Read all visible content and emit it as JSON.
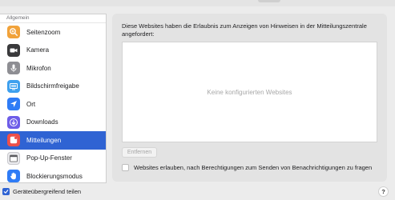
{
  "sidebar": {
    "header": "Allgemein",
    "items": [
      {
        "label": "Seitenzoom",
        "icon": "zoom-icon",
        "color": "#f1a23a"
      },
      {
        "label": "Kamera",
        "icon": "camera-icon",
        "color": "#3a3a3c"
      },
      {
        "label": "Mikrofon",
        "icon": "microphone-icon",
        "color": "#8e8e93"
      },
      {
        "label": "Bildschirmfreigabe",
        "icon": "screen-share-icon",
        "color": "#3ea0ee"
      },
      {
        "label": "Ort",
        "icon": "location-icon",
        "color": "#2f7cf6"
      },
      {
        "label": "Downloads",
        "icon": "download-icon",
        "color": "#6e5de8"
      },
      {
        "label": "Mitteilungen",
        "icon": "notifications-icon",
        "color": "#ee4f4a",
        "selected": true
      },
      {
        "label": "Pop-Up-Fenster",
        "icon": "popup-window-icon",
        "color": "#5b5b5f"
      },
      {
        "label": "Blockierungsmodus",
        "icon": "hand-icon",
        "color": "#2f7cf6"
      }
    ]
  },
  "panel": {
    "description": "Diese Websites haben die Erlaubnis zum Anzeigen von Hinweisen in der Mitteilungszentrale angefordert:",
    "empty_list": "Keine konfigurierten Websites",
    "remove_label": "Entfernen",
    "ask_label": "Websites erlauben, nach Berechtigungen zum Senden von Benachrichtigungen zu fragen",
    "ask_checked": false
  },
  "footer": {
    "share_label": "Geräteübergreifend teilen",
    "share_checked": true,
    "help_label": "?"
  },
  "colors": {
    "accent": "#2f63d3"
  }
}
